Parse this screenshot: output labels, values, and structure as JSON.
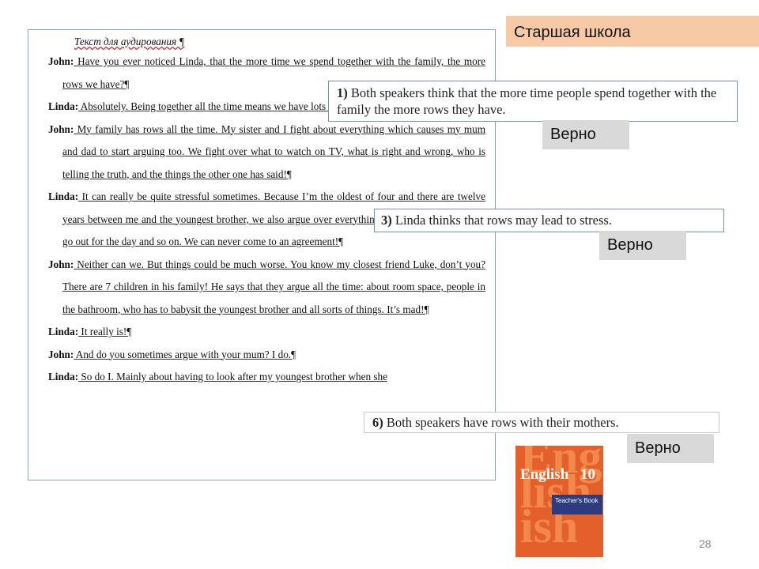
{
  "header": {
    "title": "Старшая школа"
  },
  "document": {
    "title": "Текст для аудирования ¶",
    "paragraphs": [
      {
        "speaker": "John:",
        "text": " Have you ever noticed Linda, that the more time we spend together with the family, the more rows we have?¶"
      },
      {
        "speaker": "Linda:",
        "text": " Absolutely. Being together all the time means we have lots of arguments, not just a few rows. ¶"
      },
      {
        "speaker": "John:",
        "text": " My family has rows all the time. My sister and I fight about everything which causes my mum and dad to start arguing too. We fight over what to watch on TV, what is right and wrong, who is telling the truth, and the things the other one has said!¶"
      },
      {
        "speaker": "Linda:",
        "text": " It can really be quite stressful sometimes. Because I’m the oldest of four and there are twelve years between me and the youngest brother, we also argue over everything: TV, computer, where to go out for the day and so on. We can never come to an agreement!¶"
      },
      {
        "speaker": "John:",
        "text": " Neither can we. But things could be much worse. You know my closest friend Luke, don’t you? There are 7 children in his family! He says that they argue all the time: about room space, people in the bathroom, who has to babysit the youngest brother and all sorts of things. It’s mad!¶"
      },
      {
        "speaker": "Linda:",
        "text": " It really is!¶"
      },
      {
        "speaker": "John:",
        "text": " And do you sometimes argue with your mum? I do.¶"
      },
      {
        "speaker": "Linda:",
        "text": " So do I. Mainly about having to look after my youngest brother when she"
      }
    ]
  },
  "statements": [
    {
      "num": "1)",
      "text": "Both speakers think that the more time people spend together with the family the more rows they have."
    },
    {
      "num": "3)",
      "text": "Linda thinks that rows may lead to stress."
    },
    {
      "num": "6)",
      "text": "Both speakers have rows with their mothers."
    }
  ],
  "badges": [
    "Верно",
    "Верно",
    "Верно"
  ],
  "book": {
    "title": "English",
    "number": "10",
    "label": "Teacher's Book",
    "cover_color": "#e4602a"
  },
  "page_number": "28"
}
